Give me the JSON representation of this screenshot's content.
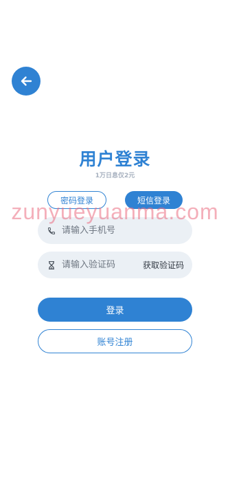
{
  "header": {
    "back_icon": "arrow-left-icon",
    "title": "用户登录",
    "subtitle": "1万日息仅2元"
  },
  "tabs": {
    "password_label": "密码登录",
    "sms_label": "短信登录",
    "active": "sms"
  },
  "watermark": "zunyueyuanma.com",
  "form": {
    "phone": {
      "icon": "phone-icon",
      "placeholder": "请输入手机号",
      "value": ""
    },
    "code": {
      "icon": "hourglass-icon",
      "placeholder": "请输入验证码",
      "value": "",
      "get_code_label": "获取验证码"
    }
  },
  "actions": {
    "login_label": "登录",
    "register_label": "账号注册"
  },
  "colors": {
    "accent": "#2f82d3",
    "field_bg": "#ebf0f5",
    "subtitle": "#a7b1bf",
    "watermark": "#eb6e82"
  }
}
